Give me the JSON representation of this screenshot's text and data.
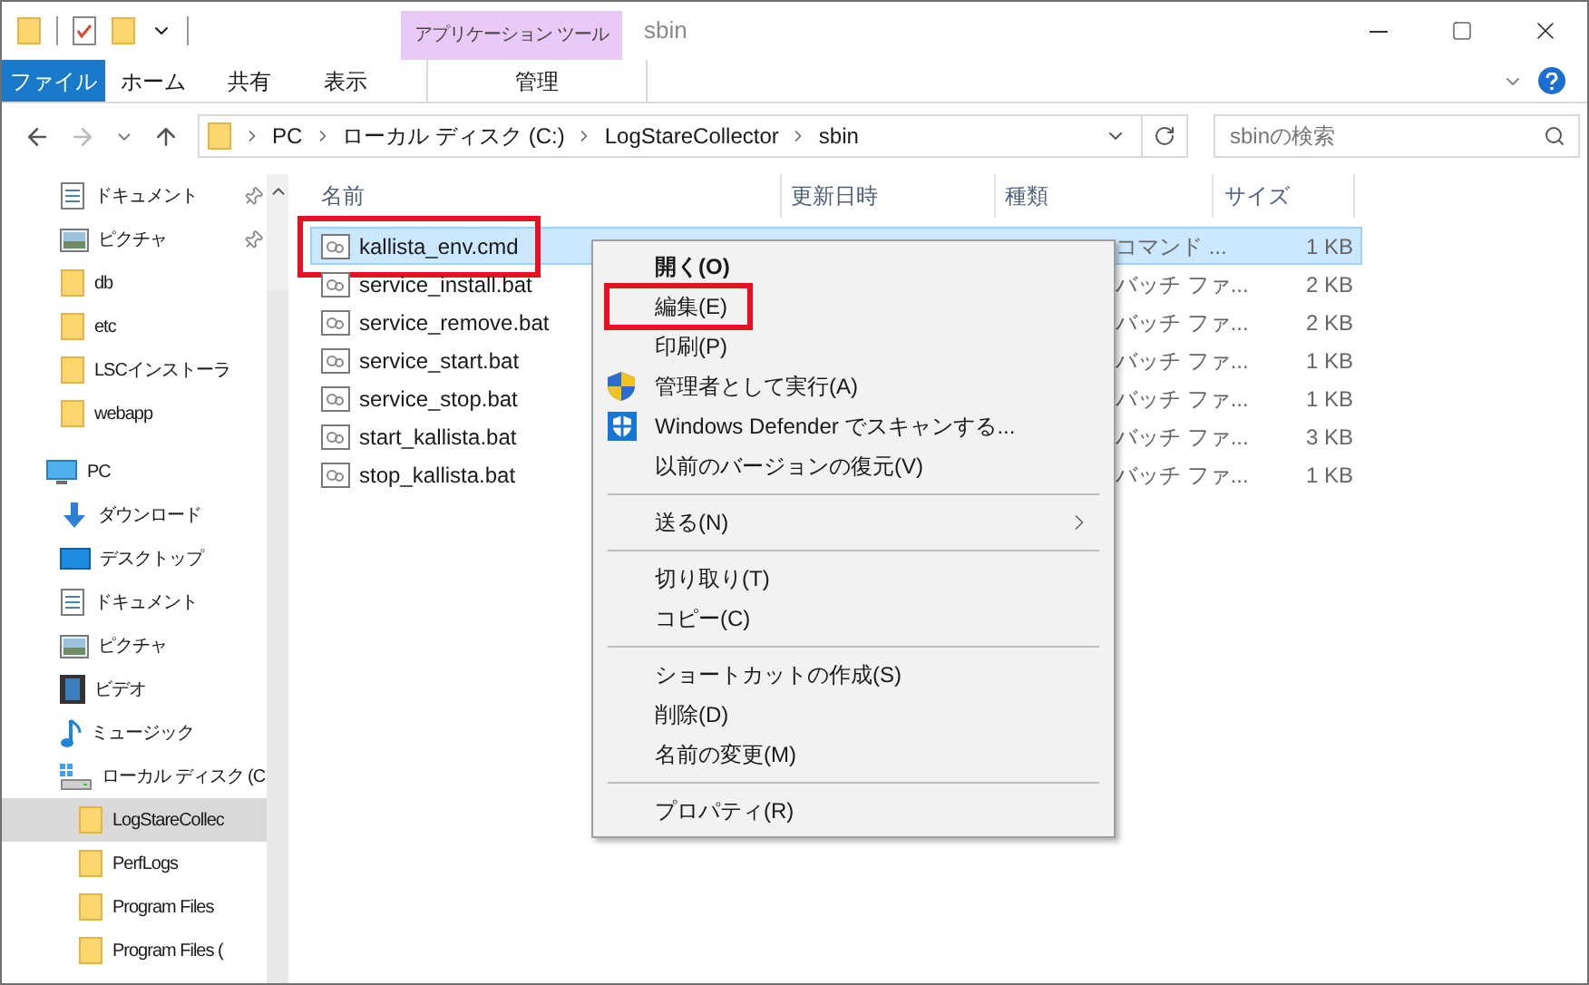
{
  "window": {
    "title": "sbin",
    "context_tab_group": "アプリケーション ツール"
  },
  "ribbon_tabs": [
    {
      "label": "ファイル",
      "kind": "file",
      "selected": false
    },
    {
      "label": "ホーム",
      "kind": "tab",
      "selected": false
    },
    {
      "label": "共有",
      "kind": "tab",
      "selected": false
    },
    {
      "label": "表示",
      "kind": "tab",
      "selected": false
    },
    {
      "label": "管理",
      "kind": "context",
      "selected": false
    }
  ],
  "address": {
    "crumbs": [
      "PC",
      "ローカル ディスク (C:)",
      "LogStareCollector",
      "sbin"
    ]
  },
  "search": {
    "placeholder": "sbinの検索"
  },
  "nav": [
    {
      "label": "ドキュメント",
      "kind": "document",
      "pinned": true,
      "selected": false
    },
    {
      "label": "ピクチャ",
      "kind": "picture",
      "pinned": true,
      "selected": false
    },
    {
      "label": "db",
      "kind": "folder",
      "pinned": false,
      "selected": false
    },
    {
      "label": "etc",
      "kind": "folder",
      "pinned": false,
      "selected": false
    },
    {
      "label": "LSCインストーラ",
      "kind": "folder",
      "pinned": false,
      "selected": false
    },
    {
      "label": "webapp",
      "kind": "folder",
      "pinned": false,
      "selected": false
    },
    {
      "label": "PC",
      "kind": "pc",
      "selected": false,
      "children": [
        {
          "label": "ダウンロード",
          "kind": "download",
          "selected": false
        },
        {
          "label": "デスクトップ",
          "kind": "desktop",
          "selected": false
        },
        {
          "label": "ドキュメント",
          "kind": "document",
          "selected": false
        },
        {
          "label": "ピクチャ",
          "kind": "picture",
          "selected": false
        },
        {
          "label": "ビデオ",
          "kind": "video",
          "selected": false
        },
        {
          "label": "ミュージック",
          "kind": "music",
          "selected": false
        },
        {
          "label": "ローカル ディスク (C",
          "kind": "drive",
          "selected": false,
          "children": [
            {
              "label": "LogStareCollec",
              "kind": "folder",
              "selected": true
            },
            {
              "label": "PerfLogs",
              "kind": "folder",
              "selected": false
            },
            {
              "label": "Program Files",
              "kind": "folder",
              "selected": false
            },
            {
              "label": "Program Files (",
              "kind": "folder",
              "selected": false
            }
          ]
        }
      ]
    }
  ],
  "table": {
    "columns": [
      "名前",
      "更新日時",
      "種類",
      "サイズ"
    ],
    "rows": [
      {
        "name": "kallista_env.cmd",
        "type": "コマンド ...",
        "size": "1 KB",
        "selected": true,
        "highlighted": true
      },
      {
        "name": "service_install.bat",
        "type": "バッチ ファ...",
        "size": "2 KB",
        "selected": false,
        "highlighted": false
      },
      {
        "name": "service_remove.bat",
        "type": "バッチ ファ...",
        "size": "2 KB",
        "selected": false,
        "highlighted": false
      },
      {
        "name": "service_start.bat",
        "type": "バッチ ファ...",
        "size": "1 KB",
        "selected": false,
        "highlighted": false
      },
      {
        "name": "service_stop.bat",
        "type": "バッチ ファ...",
        "size": "1 KB",
        "selected": false,
        "highlighted": false
      },
      {
        "name": "start_kallista.bat",
        "type": "バッチ ファ...",
        "size": "3 KB",
        "selected": false,
        "highlighted": false
      },
      {
        "name": "stop_kallista.bat",
        "type": "バッチ ファ...",
        "size": "1 KB",
        "selected": false,
        "highlighted": false
      }
    ]
  },
  "context_menu": [
    [
      {
        "label": "開く(O)",
        "bold": true,
        "highlighted": false,
        "submenu": false,
        "kind": "plain"
      },
      {
        "label": "編集(E)",
        "bold": false,
        "highlighted": true,
        "submenu": false,
        "kind": "plain"
      },
      {
        "label": "印刷(P)",
        "bold": false,
        "highlighted": false,
        "submenu": false,
        "kind": "plain"
      },
      {
        "label": "管理者として実行(A)",
        "bold": false,
        "highlighted": false,
        "submenu": false,
        "kind": "shield"
      },
      {
        "label": "Windows Defender でスキャンする...",
        "bold": false,
        "highlighted": false,
        "submenu": false,
        "kind": "defender"
      },
      {
        "label": "以前のバージョンの復元(V)",
        "bold": false,
        "highlighted": false,
        "submenu": false,
        "kind": "plain"
      }
    ],
    [
      {
        "label": "送る(N)",
        "bold": false,
        "highlighted": false,
        "submenu": true,
        "kind": "plain"
      }
    ],
    [
      {
        "label": "切り取り(T)",
        "bold": false,
        "highlighted": false,
        "submenu": false,
        "kind": "plain"
      },
      {
        "label": "コピー(C)",
        "bold": false,
        "highlighted": false,
        "submenu": false,
        "kind": "plain"
      }
    ],
    [
      {
        "label": "ショートカットの作成(S)",
        "bold": false,
        "highlighted": false,
        "submenu": false,
        "kind": "plain"
      },
      {
        "label": "削除(D)",
        "bold": false,
        "highlighted": false,
        "submenu": false,
        "kind": "plain"
      },
      {
        "label": "名前の変更(M)",
        "bold": false,
        "highlighted": false,
        "submenu": false,
        "kind": "plain"
      }
    ],
    [
      {
        "label": "プロパティ(R)",
        "bold": false,
        "highlighted": false,
        "submenu": false,
        "kind": "plain"
      }
    ]
  ]
}
